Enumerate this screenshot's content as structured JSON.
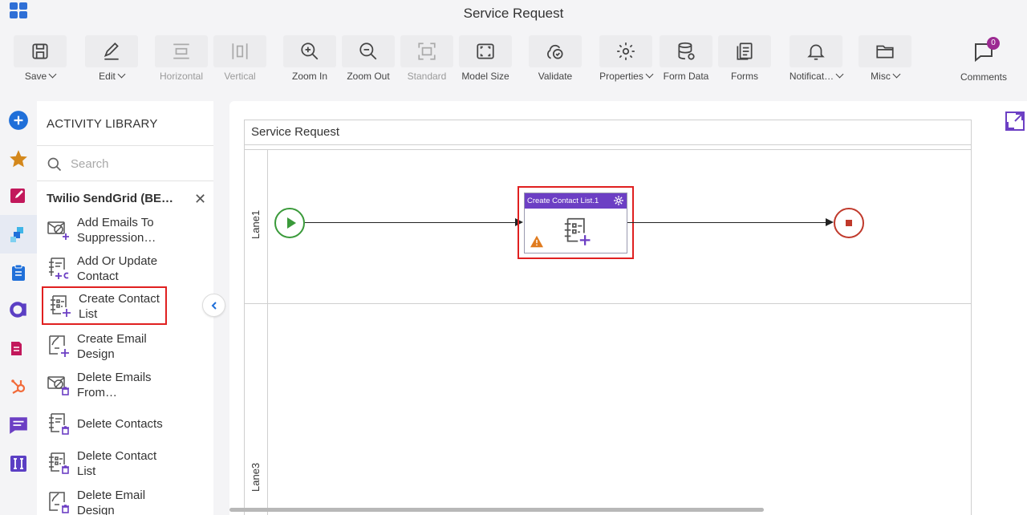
{
  "title": "Service Request",
  "toolbar": {
    "save": "Save",
    "edit": "Edit",
    "horizontal": "Horizontal",
    "vertical": "Vertical",
    "zoom_in": "Zoom In",
    "zoom_out": "Zoom Out",
    "standard": "Standard",
    "model_size": "Model Size",
    "validate": "Validate",
    "properties": "Properties",
    "form_data": "Form Data",
    "forms": "Forms",
    "notifications": "Notificat…",
    "misc": "Misc",
    "comments": "Comments",
    "comments_count": "0"
  },
  "library": {
    "title": "ACTIVITY LIBRARY",
    "search_placeholder": "Search",
    "group": "Twilio SendGrid (BE…",
    "items": [
      {
        "label": "Add Emails To Suppression…"
      },
      {
        "label": "Add Or Update Contact"
      },
      {
        "label": "Create Contact List"
      },
      {
        "label": "Create Email Design"
      },
      {
        "label": "Delete Emails From…"
      },
      {
        "label": "Delete Contacts"
      },
      {
        "label": "Delete Contact List"
      },
      {
        "label": "Delete Email Design"
      }
    ]
  },
  "canvas": {
    "pool_title": "Service Request",
    "lane1": "Lane1",
    "lane3": "Lane3",
    "activity_title": "Create Contact List.1"
  },
  "colors": {
    "accent": "#6c3fc4",
    "highlight": "#e02020",
    "start": "#3a9a3a",
    "end": "#c0392b"
  }
}
